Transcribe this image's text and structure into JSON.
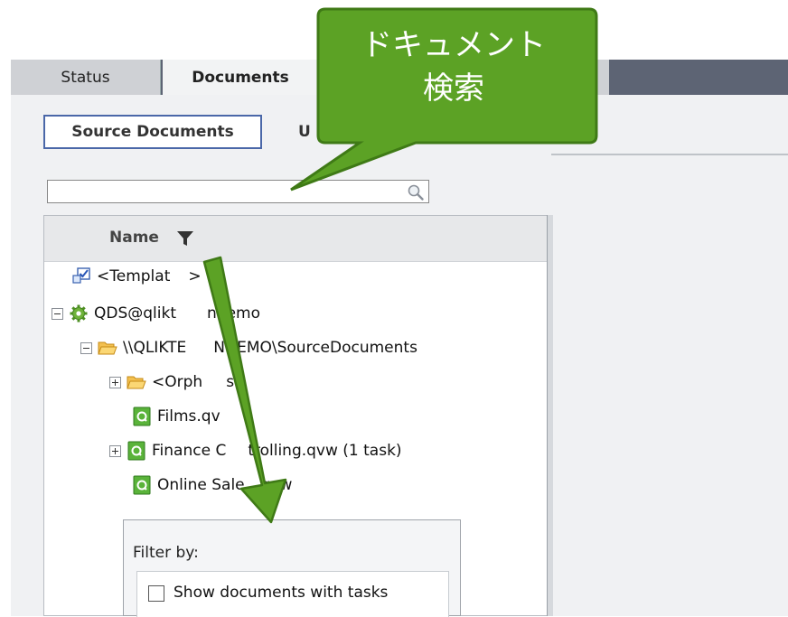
{
  "tabs": {
    "status": "Status",
    "documents": "Documents"
  },
  "subtabs": {
    "source_documents": "Source Documents",
    "other_partial": "U"
  },
  "search": {
    "value": "",
    "icon": "search-icon"
  },
  "tree": {
    "column_header": "Name",
    "rows": [
      {
        "label": "<Templat",
        "label_tail": ">"
      },
      {
        "label": "QDS@qlikt",
        "label_tail": "ndemo"
      },
      {
        "label": "\\\\QLIKTE",
        "label_tail": "NDEMO\\SourceDocuments"
      },
      {
        "label": "<Orph",
        "label_tail": "s>"
      },
      {
        "label": "Films.qv",
        "label_tail": ""
      },
      {
        "label": "Finance C",
        "label_tail": "trolling.qvw (1 task)"
      },
      {
        "label": "Online Sale",
        "label_tail": "qvw"
      }
    ]
  },
  "filter_popup": {
    "title": "Filter by:",
    "option_label": "Show documents with tasks",
    "option_checked": false
  },
  "annotation": {
    "line1": "ドキュメント",
    "line2": "検索",
    "color": "#5ca225",
    "border": "#3f7a16"
  }
}
